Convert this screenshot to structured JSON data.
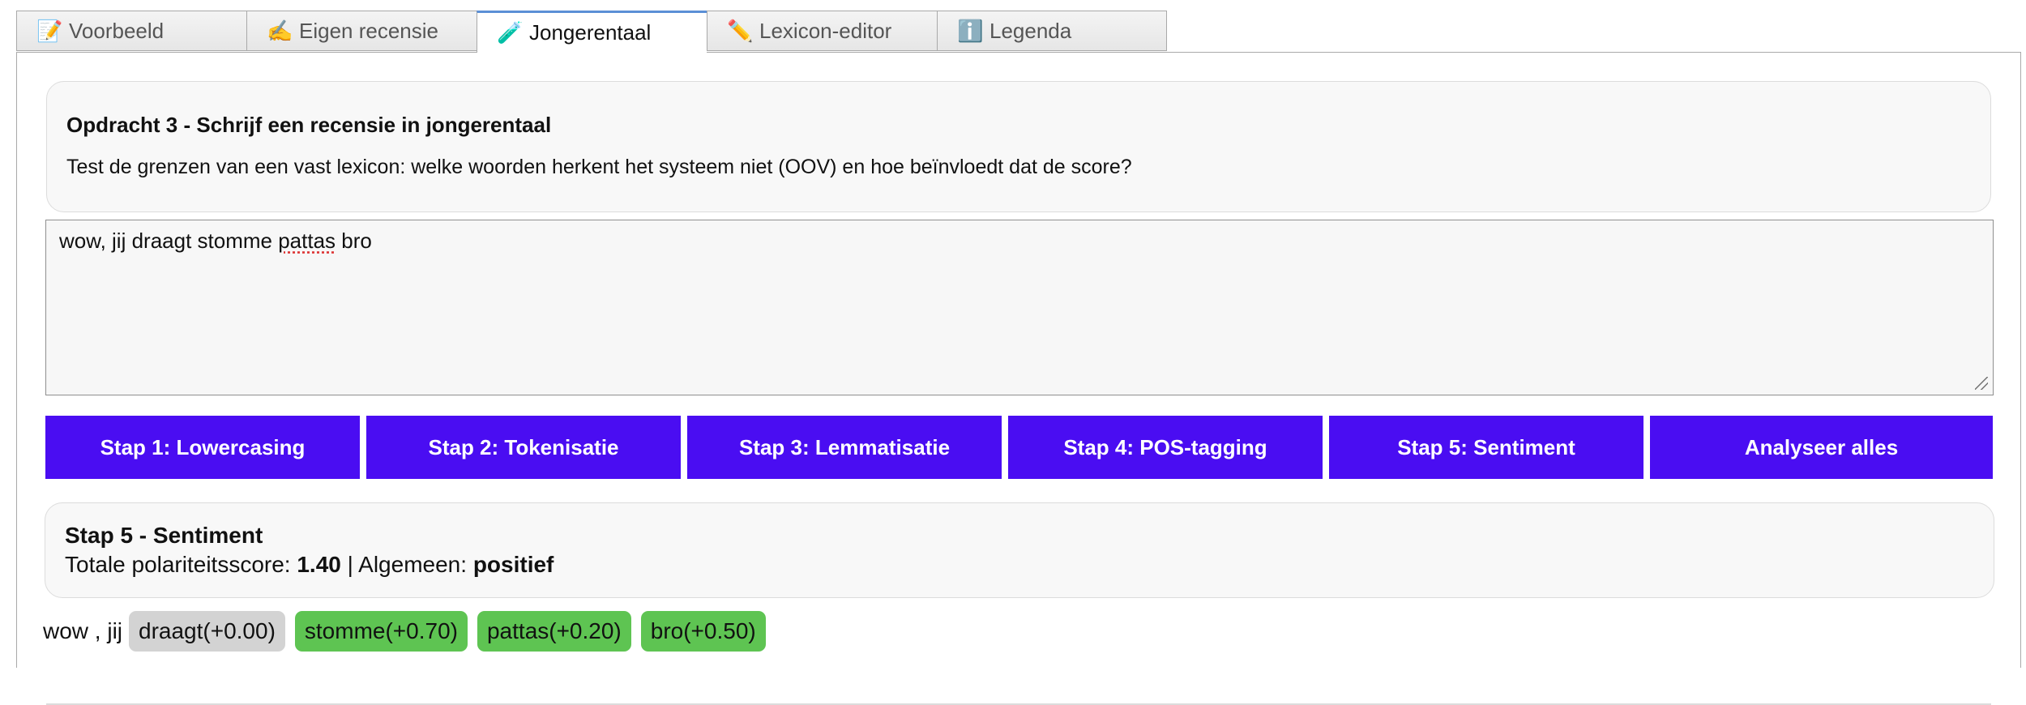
{
  "tabs": [
    {
      "label": "Voorbeeld",
      "icon": "memo-icon",
      "glyph": "📝",
      "active": false
    },
    {
      "label": "Eigen recensie",
      "icon": "writing-hand-icon",
      "glyph": "✍️",
      "active": false
    },
    {
      "label": "Jongerentaal",
      "icon": "test-tube-icon",
      "glyph": "🧪",
      "active": true
    },
    {
      "label": "Lexicon-editor",
      "icon": "pencil-icon",
      "glyph": "✏️",
      "active": false
    },
    {
      "label": "Legenda",
      "icon": "info-icon",
      "glyph": "ℹ️",
      "active": false
    }
  ],
  "task": {
    "title": "Opdracht 3 - Schrijf een recensie in jongerentaal",
    "description": "Test de grenzen van een vast lexicon: welke woorden herkent het systeem niet (OOV) en hoe beïnvloedt dat de score?"
  },
  "input": {
    "value": "wow, jij draagt stomme pattas bro"
  },
  "buttons": {
    "step1": "Stap 1: Lowercasing",
    "step2": "Stap 2: Tokenisatie",
    "step3": "Stap 3: Lemmatisatie",
    "step4": "Stap 4: POS-tagging",
    "step5": "Stap 5: Sentiment",
    "analyse": "Analyseer alles"
  },
  "result": {
    "title": "Stap 5 - Sentiment",
    "score_label": "Totale polariteitsscore:",
    "score_value": "1.40",
    "separator": "|",
    "overall_label": "Algemeen:",
    "overall_value": "positief"
  },
  "tokens": {
    "plain": "wow , jij",
    "chips": [
      {
        "text": "draagt(+0.00)",
        "kind": "neutral"
      },
      {
        "text": "stomme(+0.70)",
        "kind": "pos"
      },
      {
        "text": "pattas(+0.20)",
        "kind": "pos"
      },
      {
        "text": "bro(+0.50)",
        "kind": "pos"
      }
    ]
  },
  "colors": {
    "button": "#4a0df2",
    "chip_positive": "#5ec452",
    "chip_neutral": "#d3d3d3",
    "active_tab_top": "#5b8fd6"
  }
}
